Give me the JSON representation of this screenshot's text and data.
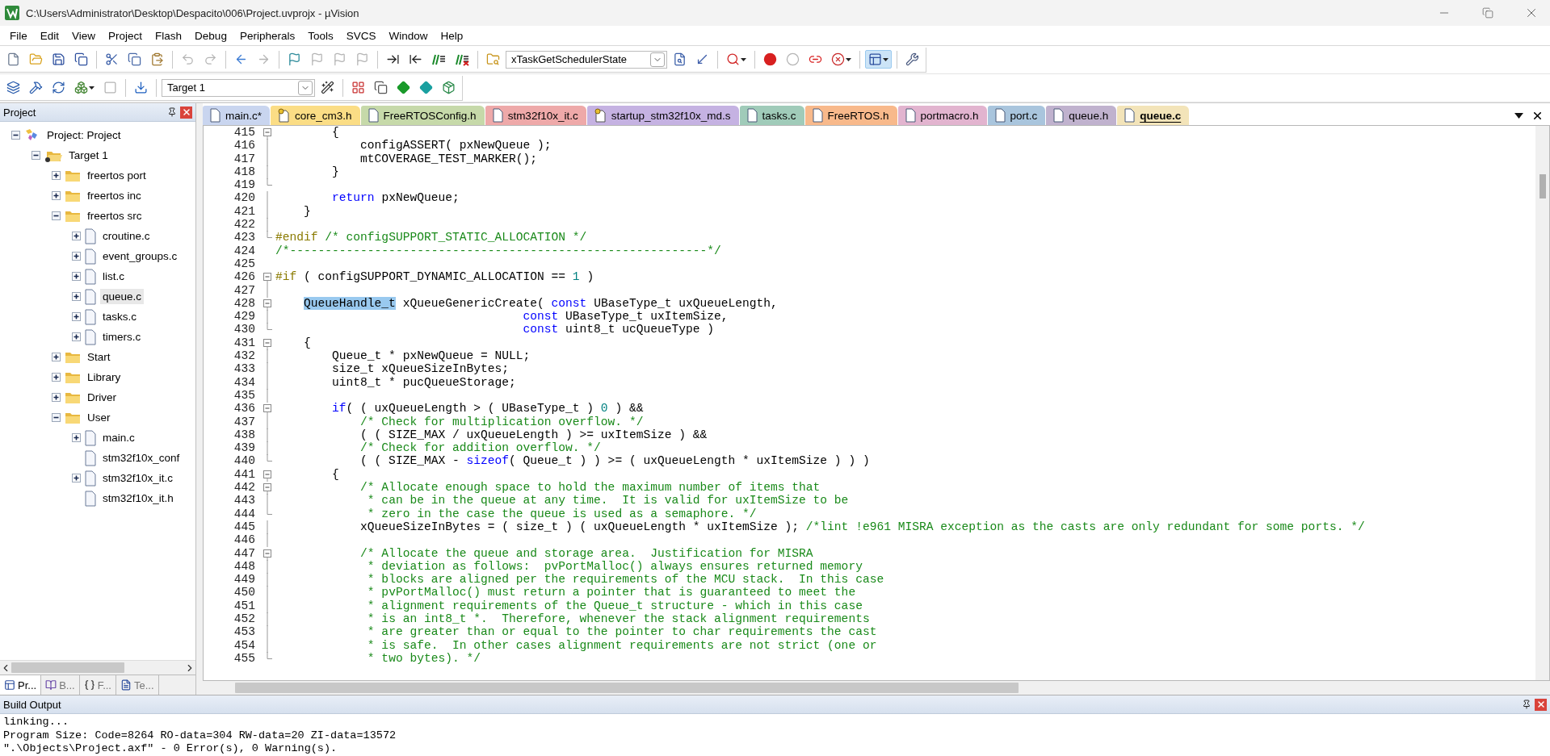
{
  "window": {
    "title": "C:\\Users\\Administrator\\Desktop\\Despacito\\006\\Project.uvprojx - µVision"
  },
  "menu": [
    "File",
    "Edit",
    "View",
    "Project",
    "Flash",
    "Debug",
    "Peripherals",
    "Tools",
    "SVCS",
    "Window",
    "Help"
  ],
  "toolbars": [
    {
      "items": [
        {
          "kind": "button",
          "disabled": false,
          "pressed": false
        },
        {
          "kind": "button",
          "disabled": false,
          "pressed": false
        },
        {
          "kind": "button",
          "disabled": false,
          "pressed": false
        },
        {
          "kind": "button",
          "disabled": false,
          "pressed": false
        },
        {
          "kind": "separator"
        },
        {
          "kind": "button",
          "disabled": false,
          "pressed": false
        },
        {
          "kind": "button",
          "disabled": false,
          "pressed": false
        },
        {
          "kind": "button",
          "disabled": false,
          "pressed": false
        },
        {
          "kind": "separator"
        },
        {
          "kind": "button",
          "disabled": true,
          "pressed": false
        },
        {
          "kind": "button",
          "disabled": true,
          "pressed": false
        },
        {
          "kind": "separator"
        },
        {
          "kind": "button",
          "disabled": false,
          "pressed": false
        },
        {
          "kind": "button",
          "disabled": true,
          "pressed": false
        },
        {
          "kind": "separator"
        },
        {
          "kind": "button",
          "disabled": false,
          "pressed": false
        },
        {
          "kind": "button",
          "disabled": true,
          "pressed": false
        },
        {
          "kind": "button",
          "disabled": true,
          "pressed": false
        },
        {
          "kind": "button",
          "disabled": true,
          "pressed": false
        },
        {
          "kind": "separator"
        },
        {
          "kind": "button",
          "disabled": false,
          "pressed": false
        },
        {
          "kind": "button",
          "disabled": false,
          "pressed": false
        },
        {
          "kind": "button",
          "disabled": false,
          "pressed": false
        },
        {
          "kind": "button",
          "disabled": false,
          "pressed": false
        },
        {
          "kind": "separator"
        },
        {
          "kind": "button",
          "disabled": false,
          "pressed": false
        },
        {
          "kind": "combo",
          "value": "xTaskGetSchedulerState"
        },
        {
          "kind": "button",
          "disabled": false,
          "pressed": false
        },
        {
          "kind": "button",
          "disabled": false,
          "pressed": false
        },
        {
          "kind": "separator"
        },
        {
          "kind": "menu_button",
          "disabled": false,
          "pressed": false
        },
        {
          "kind": "separator"
        },
        {
          "kind": "button",
          "disabled": false,
          "pressed": false
        },
        {
          "kind": "button",
          "disabled": true,
          "pressed": false
        },
        {
          "kind": "button",
          "disabled": false,
          "pressed": false
        },
        {
          "kind": "menu_button",
          "disabled": false,
          "pressed": false
        },
        {
          "kind": "separator"
        },
        {
          "kind": "menu_button",
          "disabled": false,
          "pressed": true
        },
        {
          "kind": "separator"
        },
        {
          "kind": "button",
          "disabled": false,
          "pressed": false
        }
      ]
    },
    {
      "items": [
        {
          "kind": "button",
          "disabled": false,
          "pressed": false
        },
        {
          "kind": "button",
          "disabled": false,
          "pressed": false
        },
        {
          "kind": "button",
          "disabled": false,
          "pressed": false
        },
        {
          "kind": "menu_button",
          "disabled": false,
          "pressed": false
        },
        {
          "kind": "button",
          "disabled": true,
          "pressed": false
        },
        {
          "kind": "separator"
        },
        {
          "kind": "button",
          "disabled": false,
          "pressed": false
        },
        {
          "kind": "separator"
        },
        {
          "kind": "combo",
          "value": "Target 1"
        },
        {
          "kind": "button",
          "disabled": false,
          "pressed": false
        },
        {
          "kind": "separator"
        },
        {
          "kind": "button",
          "disabled": false,
          "pressed": false
        },
        {
          "kind": "button",
          "disabled": false,
          "pressed": false
        },
        {
          "kind": "button",
          "disabled": false,
          "pressed": false
        },
        {
          "kind": "button",
          "disabled": false,
          "pressed": false
        },
        {
          "kind": "button",
          "disabled": false,
          "pressed": false
        }
      ]
    }
  ],
  "project_panel": {
    "title": "Project",
    "tree": [
      {
        "label": "Project: Project",
        "kind": "project",
        "leaf": false,
        "expanded": true,
        "selected": false,
        "children": [
          {
            "label": "Target 1",
            "kind": "target",
            "leaf": false,
            "expanded": true,
            "selected": false,
            "children": [
              {
                "label": "freertos port",
                "kind": "folder",
                "leaf": false,
                "expanded": false,
                "selected": false
              },
              {
                "label": "freertos inc",
                "kind": "folder",
                "leaf": false,
                "expanded": false,
                "selected": false
              },
              {
                "label": "freertos src",
                "kind": "folder",
                "leaf": false,
                "expanded": true,
                "selected": false,
                "children": [
                  {
                    "label": "croutine.c",
                    "kind": "file",
                    "leaf": false,
                    "expanded": false,
                    "selected": false
                  },
                  {
                    "label": "event_groups.c",
                    "kind": "file",
                    "leaf": false,
                    "expanded": false,
                    "selected": false
                  },
                  {
                    "label": "list.c",
                    "kind": "file",
                    "leaf": false,
                    "expanded": false,
                    "selected": false
                  },
                  {
                    "label": "queue.c",
                    "kind": "file",
                    "leaf": false,
                    "expanded": false,
                    "selected": true
                  },
                  {
                    "label": "tasks.c",
                    "kind": "file",
                    "leaf": false,
                    "expanded": false,
                    "selected": false
                  },
                  {
                    "label": "timers.c",
                    "kind": "file",
                    "leaf": false,
                    "expanded": false,
                    "selected": false
                  }
                ]
              },
              {
                "label": "Start",
                "kind": "folder",
                "leaf": false,
                "expanded": false,
                "selected": false
              },
              {
                "label": "Library",
                "kind": "folder",
                "leaf": false,
                "expanded": false,
                "selected": false
              },
              {
                "label": "Driver",
                "kind": "folder",
                "leaf": false,
                "expanded": false,
                "selected": false
              },
              {
                "label": "User",
                "kind": "folder",
                "leaf": false,
                "expanded": true,
                "selected": false,
                "children": [
                  {
                    "label": "main.c",
                    "kind": "file",
                    "leaf": false,
                    "expanded": false,
                    "selected": false
                  },
                  {
                    "label": "stm32f10x_conf",
                    "kind": "file",
                    "leaf": true,
                    "selected": false
                  },
                  {
                    "label": "stm32f10x_it.c",
                    "kind": "file",
                    "leaf": false,
                    "expanded": false,
                    "selected": false
                  },
                  {
                    "label": "stm32f10x_it.h",
                    "kind": "file",
                    "leaf": true,
                    "selected": false
                  }
                ]
              }
            ]
          }
        ]
      }
    ],
    "bottom_tabs": [
      {
        "label": "Pr...",
        "selected": true
      },
      {
        "label": "B...",
        "selected": false
      },
      {
        "label": "F...",
        "selected": false
      },
      {
        "label": "Te...",
        "selected": false
      }
    ]
  },
  "editor": {
    "tabs": [
      {
        "label": "main.c*",
        "color": "#c9d5ef",
        "read_only": false,
        "selected": false
      },
      {
        "label": "core_cm3.h",
        "color": "#fbdd85",
        "read_only": true,
        "selected": false
      },
      {
        "label": "FreeRTOSConfig.h",
        "color": "#c6d9a9",
        "read_only": false,
        "selected": false
      },
      {
        "label": "stm32f10x_it.c",
        "color": "#eea9a9",
        "read_only": false,
        "selected": false
      },
      {
        "label": "startup_stm32f10x_md.s",
        "color": "#c5b2e2",
        "read_only": true,
        "selected": false
      },
      {
        "label": "tasks.c",
        "color": "#a0cbb9",
        "read_only": false,
        "selected": false
      },
      {
        "label": "FreeRTOS.h",
        "color": "#f8b98b",
        "read_only": false,
        "selected": false
      },
      {
        "label": "portmacro.h",
        "color": "#e2b4cf",
        "read_only": false,
        "selected": false
      },
      {
        "label": "port.c",
        "color": "#a9c5dd",
        "read_only": false,
        "selected": false
      },
      {
        "label": "queue.h",
        "color": "#c0b2ce",
        "read_only": false,
        "selected": false
      },
      {
        "label": "queue.c",
        "color": "#f3e4b9",
        "read_only": false,
        "selected": true
      }
    ],
    "lines": [
      {
        "number": "415",
        "kind": "fold_start",
        "segments": [
          {
            "kind": "plain",
            "text": "        {"
          }
        ]
      },
      {
        "number": "416",
        "kind": "fold_body",
        "segments": [
          {
            "kind": "plain",
            "text": "            configASSERT( pxNewQueue );"
          }
        ]
      },
      {
        "number": "417",
        "kind": "fold_body",
        "segments": [
          {
            "kind": "plain",
            "text": "            mtCOVERAGE_TEST_MARKER();"
          }
        ]
      },
      {
        "number": "418",
        "kind": "fold_body",
        "segments": [
          {
            "kind": "plain",
            "text": "        }"
          }
        ]
      },
      {
        "number": "419",
        "kind": "fold_end"
      },
      {
        "number": "420",
        "kind": "fold_body",
        "segments": [
          {
            "kind": "keyword",
            "text": "        return"
          },
          {
            "kind": "plain",
            "text": " pxNewQueue;"
          }
        ]
      },
      {
        "number": "421",
        "kind": "fold_body",
        "segments": [
          {
            "kind": "plain",
            "text": "    }"
          }
        ]
      },
      {
        "number": "422",
        "kind": "fold_body"
      },
      {
        "number": "423",
        "kind": "fold_end",
        "segments": [
          {
            "kind": "preprocessor",
            "text": "#endif"
          },
          {
            "kind": "comment",
            "text": " /* configSUPPORT_STATIC_ALLOCATION */"
          }
        ]
      },
      {
        "number": "424",
        "kind": "plain",
        "segments": [
          {
            "kind": "comment",
            "text": "/*-----------------------------------------------------------*/"
          }
        ]
      },
      {
        "number": "425",
        "kind": "plain"
      },
      {
        "number": "426",
        "kind": "fold_start",
        "segments": [
          {
            "kind": "preprocessor",
            "text": "#if"
          },
          {
            "kind": "plain",
            "text": " ( configSUPPORT_DYNAMIC_ALLOCATION == "
          },
          {
            "kind": "number",
            "text": "1"
          },
          {
            "kind": "plain",
            "text": " )"
          }
        ]
      },
      {
        "number": "427",
        "kind": "fold_body"
      },
      {
        "number": "428",
        "kind": "fold_start",
        "segments": [
          {
            "kind": "highlight",
            "text": "    QueueHandle_t"
          },
          {
            "kind": "plain",
            "text": " xQueueGenericCreate( "
          },
          {
            "kind": "keyword",
            "text": "const"
          },
          {
            "kind": "plain",
            "text": " UBaseType_t uxQueueLength,"
          }
        ]
      },
      {
        "number": "429",
        "kind": "fold_body",
        "segments": [
          {
            "kind": "keyword",
            "text": "                                   const"
          },
          {
            "kind": "plain",
            "text": " UBaseType_t uxItemSize,"
          }
        ]
      },
      {
        "number": "430",
        "kind": "fold_end",
        "segments": [
          {
            "kind": "keyword",
            "text": "                                   const"
          },
          {
            "kind": "plain",
            "text": " uint8_t ucQueueType )"
          }
        ]
      },
      {
        "number": "431",
        "kind": "fold_start",
        "segments": [
          {
            "kind": "plain",
            "text": "    {"
          }
        ]
      },
      {
        "number": "432",
        "kind": "fold_body",
        "segments": [
          {
            "kind": "plain",
            "text": "        Queue_t * pxNewQueue = NULL;"
          }
        ]
      },
      {
        "number": "433",
        "kind": "fold_body",
        "segments": [
          {
            "kind": "plain",
            "text": "        size_t xQueueSizeInBytes;"
          }
        ]
      },
      {
        "number": "434",
        "kind": "fold_body",
        "segments": [
          {
            "kind": "plain",
            "text": "        uint8_t * pucQueueStorage;"
          }
        ]
      },
      {
        "number": "435",
        "kind": "fold_body"
      },
      {
        "number": "436",
        "kind": "fold_start",
        "segments": [
          {
            "kind": "keyword",
            "text": "        if"
          },
          {
            "kind": "plain",
            "text": "( ( uxQueueLength > ( UBaseType_t ) "
          },
          {
            "kind": "number",
            "text": "0"
          },
          {
            "kind": "plain",
            "text": " ) &&"
          }
        ]
      },
      {
        "number": "437",
        "kind": "fold_body",
        "segments": [
          {
            "kind": "comment",
            "text": "            /* Check for multiplication overflow. */"
          }
        ]
      },
      {
        "number": "438",
        "kind": "fold_body",
        "segments": [
          {
            "kind": "plain",
            "text": "            ( ( SIZE_MAX / uxQueueLength ) >= uxItemSize ) &&"
          }
        ]
      },
      {
        "number": "439",
        "kind": "fold_body",
        "segments": [
          {
            "kind": "comment",
            "text": "            /* Check for addition overflow. */"
          }
        ]
      },
      {
        "number": "440",
        "kind": "fold_end",
        "segments": [
          {
            "kind": "plain",
            "text": "            ( ( SIZE_MAX - "
          },
          {
            "kind": "keyword",
            "text": "sizeof"
          },
          {
            "kind": "plain",
            "text": "( Queue_t ) ) >= ( uxQueueLength * uxItemSize ) ) )"
          }
        ]
      },
      {
        "number": "441",
        "kind": "fold_start",
        "segments": [
          {
            "kind": "plain",
            "text": "        {"
          }
        ]
      },
      {
        "number": "442",
        "kind": "fold_start",
        "segments": [
          {
            "kind": "comment",
            "text": "            /* Allocate enough space to hold the maximum number of items that"
          }
        ]
      },
      {
        "number": "443",
        "kind": "fold_body",
        "segments": [
          {
            "kind": "comment",
            "text": "             * can be in the queue at any time.  It is valid for uxItemSize to be"
          }
        ]
      },
      {
        "number": "444",
        "kind": "fold_end",
        "segments": [
          {
            "kind": "comment",
            "text": "             * zero in the case the queue is used as a semaphore. */"
          }
        ]
      },
      {
        "number": "445",
        "kind": "fold_body",
        "segments": [
          {
            "kind": "plain",
            "text": "            xQueueSizeInBytes = ( size_t ) ( uxQueueLength * uxItemSize ); "
          },
          {
            "kind": "comment",
            "text": "/*lint !e961 MISRA exception as the casts are only redundant for some ports. */"
          }
        ]
      },
      {
        "number": "446",
        "kind": "fold_body"
      },
      {
        "number": "447",
        "kind": "fold_start",
        "segments": [
          {
            "kind": "comment",
            "text": "            /* Allocate the queue and storage area.  Justification for MISRA"
          }
        ]
      },
      {
        "number": "448",
        "kind": "fold_body",
        "segments": [
          {
            "kind": "comment",
            "text": "             * deviation as follows:  pvPortMalloc() always ensures returned memory"
          }
        ]
      },
      {
        "number": "449",
        "kind": "fold_body",
        "segments": [
          {
            "kind": "comment",
            "text": "             * blocks are aligned per the requirements of the MCU stack.  In this case"
          }
        ]
      },
      {
        "number": "450",
        "kind": "fold_body",
        "segments": [
          {
            "kind": "comment",
            "text": "             * pvPortMalloc() must return a pointer that is guaranteed to meet the"
          }
        ]
      },
      {
        "number": "451",
        "kind": "fold_body",
        "segments": [
          {
            "kind": "comment",
            "text": "             * alignment requirements of the Queue_t structure - which in this case"
          }
        ]
      },
      {
        "number": "452",
        "kind": "fold_body",
        "segments": [
          {
            "kind": "comment",
            "text": "             * is an int8_t *.  Therefore, whenever the stack alignment requirements"
          }
        ]
      },
      {
        "number": "453",
        "kind": "fold_body",
        "segments": [
          {
            "kind": "comment",
            "text": "             * are greater than or equal to the pointer to char requirements the cast"
          }
        ]
      },
      {
        "number": "454",
        "kind": "fold_body",
        "segments": [
          {
            "kind": "comment",
            "text": "             * is safe.  In other cases alignment requirements are not strict (one or"
          }
        ]
      },
      {
        "number": "455",
        "kind": "fold_end",
        "segments": [
          {
            "kind": "comment",
            "text": "             * two bytes). */"
          }
        ]
      }
    ]
  },
  "build_output": {
    "title": "Build Output",
    "lines": [
      "linking...",
      "Program Size: Code=8264 RO-data=304 RW-data=20 ZI-data=13572",
      "\".\\Objects\\Project.axf\" - 0 Error(s), 0 Warning(s)."
    ]
  }
}
